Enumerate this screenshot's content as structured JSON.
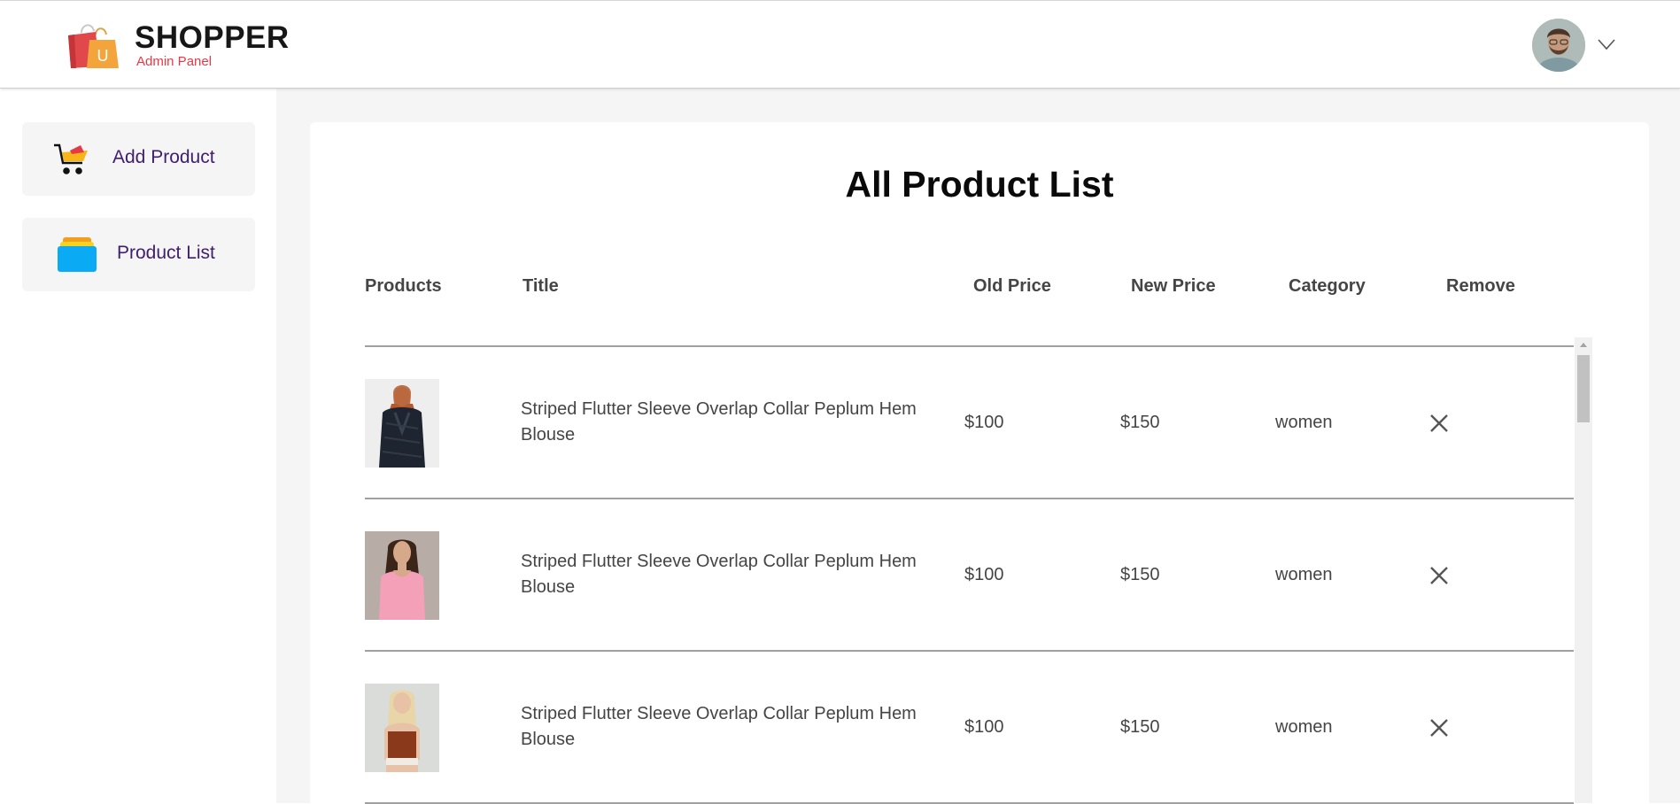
{
  "header": {
    "brand_name": "SHOPPER",
    "brand_sub": "Admin Panel",
    "logo_letter": "U"
  },
  "sidebar": {
    "items": [
      {
        "label": "Add Product",
        "icon": "cart-icon"
      },
      {
        "label": "Product List",
        "icon": "stack-icon"
      }
    ]
  },
  "main": {
    "title": "All Product List",
    "columns": [
      "Products",
      "Title",
      "Old Price",
      "New Price",
      "Category",
      "Remove"
    ],
    "rows": [
      {
        "title": "Striped Flutter Sleeve Overlap Collar Peplum Hem Blouse",
        "old_price": "$100",
        "new_price": "$150",
        "category": "women"
      },
      {
        "title": "Striped Flutter Sleeve Overlap Collar Peplum Hem Blouse",
        "old_price": "$100",
        "new_price": "$150",
        "category": "women"
      },
      {
        "title": "Striped Flutter Sleeve Overlap Collar Peplum Hem Blouse",
        "old_price": "$100",
        "new_price": "$150",
        "category": "women"
      }
    ]
  },
  "colors": {
    "accent": "#e63946",
    "sidebar_label": "#3f1e6b",
    "panel_bg": "#f5f5f5"
  }
}
